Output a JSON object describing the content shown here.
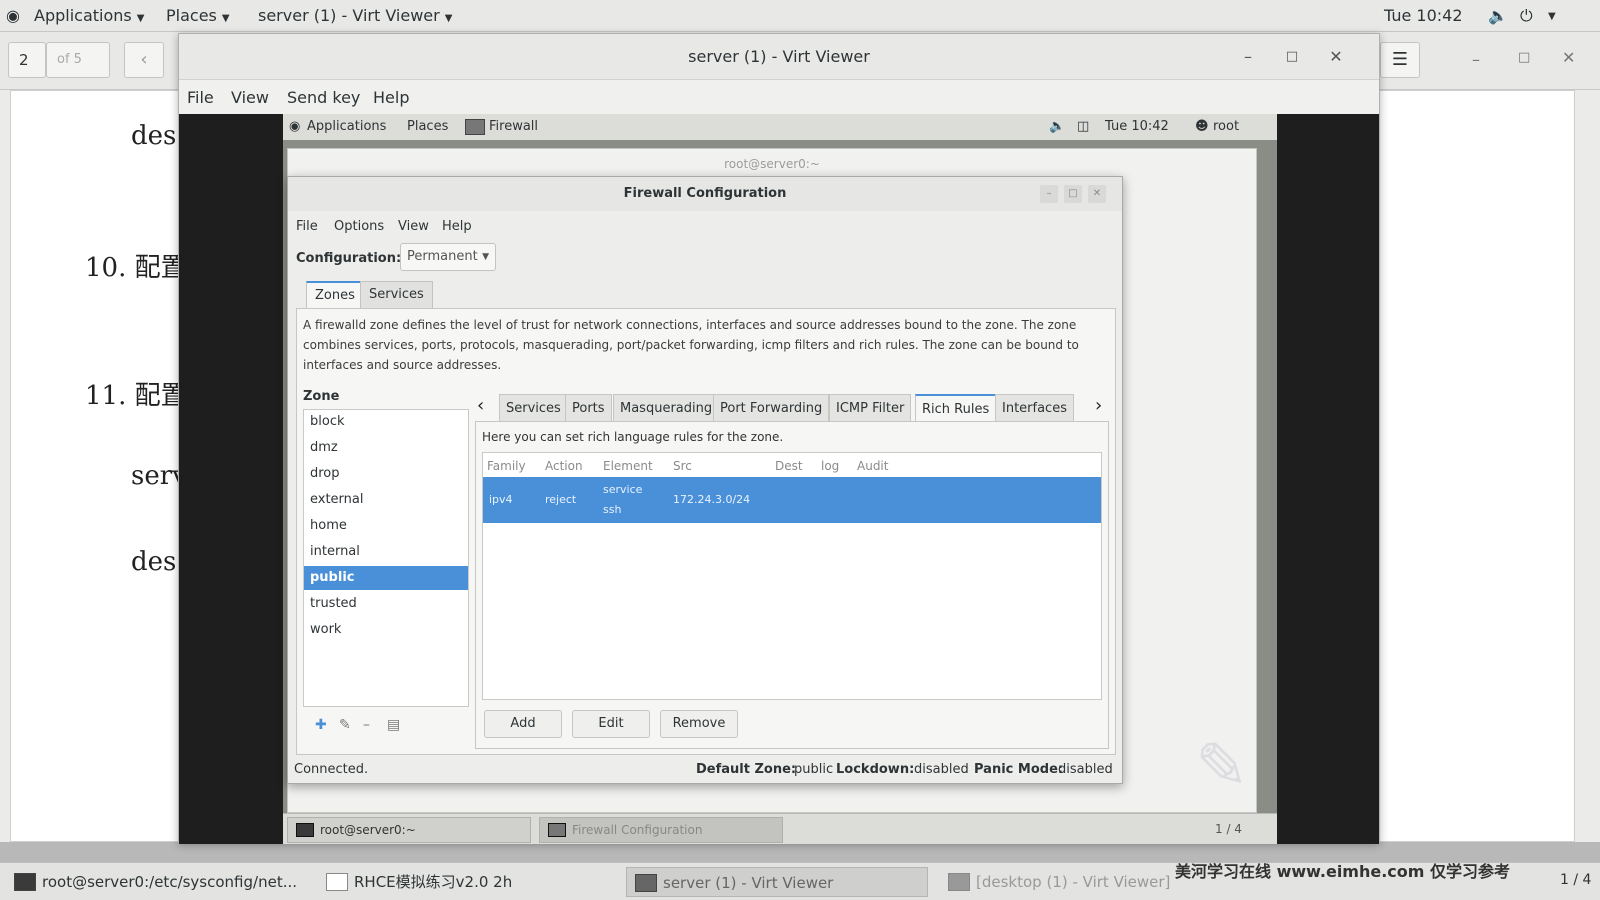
{
  "host_topbar": {
    "applications": "Applications",
    "places": "Places",
    "active_app": "server (1) - Virt Viewer",
    "clock": "Tue 10:42"
  },
  "doc_viewer": {
    "page_number": "2",
    "page_of": "of 5",
    "lines": [
      "des",
      "10. 配置",
      "11. 配置",
      "serv",
      "des"
    ]
  },
  "virt_viewer": {
    "title": "server (1) - Virt Viewer",
    "menu": [
      "File",
      "View",
      "Send key",
      "Help"
    ]
  },
  "guest_topbar": {
    "applications": "Applications",
    "places": "Places",
    "active_app": "Firewall",
    "clock": "Tue 10:42",
    "user": "root"
  },
  "terminal_title": "root@server0:~",
  "firewall": {
    "title": "Firewall Configuration",
    "menu": [
      "File",
      "Options",
      "View",
      "Help"
    ],
    "configuration_label": "Configuration:",
    "configuration_value": "Permanent",
    "top_tabs": [
      "Zones",
      "Services"
    ],
    "zone_description": "A firewalld zone defines the level of trust for network connections, interfaces and source addresses bound to the zone. The zone combines services, ports, protocols, masquerading, port/packet forwarding, icmp filters and rich rules. The zone can be bound to interfaces and source addresses.",
    "zone_heading": "Zone",
    "zones": [
      "block",
      "dmz",
      "drop",
      "external",
      "home",
      "internal",
      "public",
      "trusted",
      "work"
    ],
    "selected_zone": "public",
    "sub_tabs": [
      "Services",
      "Ports",
      "Masquerading",
      "Port Forwarding",
      "ICMP Filter",
      "Rich Rules",
      "Interfaces"
    ],
    "active_sub_tab": "Rich Rules",
    "rich_info": "Here you can set rich language rules for the zone.",
    "columns": [
      "Family",
      "Action",
      "Element",
      "Src",
      "Dest",
      "log",
      "Audit"
    ],
    "rules": [
      {
        "family": "ipv4",
        "action": "reject",
        "element_line1": "service",
        "element_line2": "ssh",
        "src": "172.24.3.0/24",
        "dest": "",
        "log": "",
        "audit": ""
      }
    ],
    "buttons": {
      "add": "Add",
      "edit": "Edit",
      "remove": "Remove"
    },
    "status": {
      "connection": "Connected.",
      "default_zone_label": "Default Zone:",
      "default_zone_value": "public",
      "lockdown_label": "Lockdown:",
      "lockdown_value": "disabled",
      "panic_label": "Panic Mode:",
      "panic_value": "disabled"
    }
  },
  "guest_taskbar": {
    "items": [
      "root@server0:~",
      "Firewall Configuration"
    ],
    "page": "1 / 4"
  },
  "host_taskbar": {
    "items": [
      "root@server0:/etc/sysconfig/net...",
      "RHCE模拟练习v2.0 2h",
      "server (1) - Virt Viewer",
      "[desktop (1) - Virt Viewer]"
    ],
    "watermark": "美河学习在线 www.eimhe.com 仅学习参考",
    "page": "1 / 4"
  }
}
